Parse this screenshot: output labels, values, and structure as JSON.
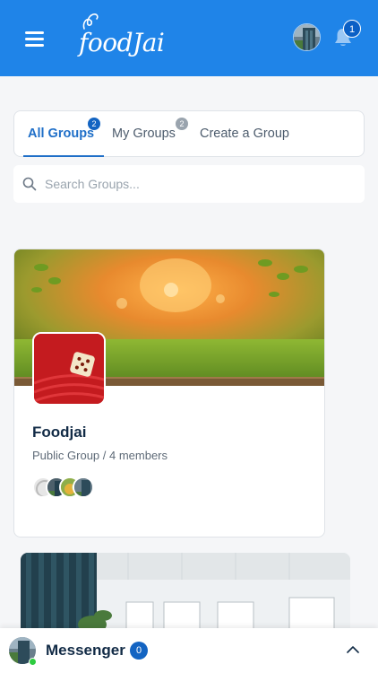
{
  "header": {
    "logo_text": "foodJai",
    "notification_count": "1"
  },
  "tabs": [
    {
      "label": "All Groups",
      "badge": "2",
      "active": true
    },
    {
      "label": "My Groups",
      "badge": "2",
      "active": false
    },
    {
      "label": "Create a Group",
      "badge": "",
      "active": false
    }
  ],
  "search": {
    "placeholder": "Search Groups..."
  },
  "groups": [
    {
      "name": "Foodjai",
      "meta": "Public Group / 4 members",
      "member_avatar_count": 4
    }
  ],
  "messenger": {
    "label": "Messenger",
    "count": "0"
  },
  "colors": {
    "header_bg": "#1f84e8",
    "accent": "#1f6fc8",
    "badge_blue": "#1364c2",
    "online": "#2ecc40"
  }
}
